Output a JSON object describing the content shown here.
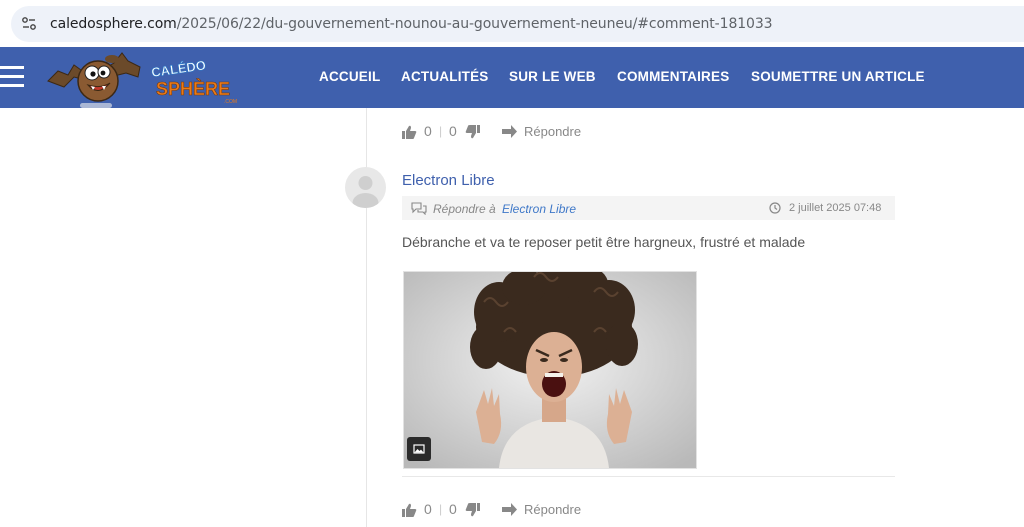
{
  "browser": {
    "url_domain": "caledosphere.com",
    "url_path": "/2025/06/22/du-gouvernement-nounou-au-gouvernement-neuneu/#comment-181033"
  },
  "nav": {
    "logo_text_top": "CALÉDO",
    "logo_text_bottom": "SPHÈRE",
    "logo_text_com": ".COM",
    "items": [
      "ACCUEIL",
      "ACTUALITÉS",
      "SUR LE WEB",
      "COMMENTAIRES",
      "SOUMETTRE UN ARTICLE"
    ]
  },
  "comment_top": {
    "likes": "0",
    "dislikes": "0",
    "reply_label": "Répondre"
  },
  "comment": {
    "author": "Electron Libre",
    "reply_to_label": "Répondre à",
    "reply_to_name": "Electron Libre",
    "date": "2 juillet 2025 07:48",
    "text": "Débranche et va te reposer petit être hargneux, frustré et malade",
    "likes": "0",
    "dislikes": "0",
    "reply_label": "Répondre"
  },
  "colors": {
    "nav_bg": "#3f60ad",
    "link": "#3f60ad",
    "reply_link": "#3f78c8"
  }
}
